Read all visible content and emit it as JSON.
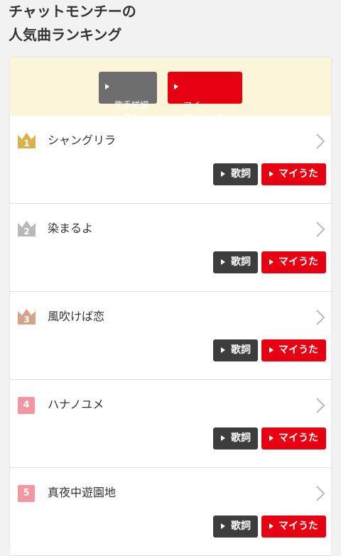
{
  "page": {
    "title": "チャットモンチーの\n人気曲ランキング"
  },
  "buttons": {
    "back_artist": "歌手詳細\nへ戻る",
    "my_artist": "マイ\nアーティスト"
  },
  "ranking": [
    {
      "rank": "1",
      "title": "シャングリラ",
      "lyrics_label": "歌詞",
      "myuta_label": "マイうた",
      "badge_color": "#d9b24c"
    },
    {
      "rank": "2",
      "title": "染まるよ",
      "lyrics_label": "歌詞",
      "myuta_label": "マイうた",
      "badge_color": "#b8b8b8"
    },
    {
      "rank": "3",
      "title": "風吹けば恋",
      "lyrics_label": "歌詞",
      "myuta_label": "マイうた",
      "badge_color": "#d4a38a"
    },
    {
      "rank": "4",
      "title": "ハナノユメ",
      "lyrics_label": "歌詞",
      "myuta_label": "マイうた",
      "badge_color": "#f5959f"
    },
    {
      "rank": "5",
      "title": "真夜中遊園地",
      "lyrics_label": "歌詞",
      "myuta_label": "マイうた",
      "badge_color": "#f5959f"
    }
  ],
  "colors": {
    "accent": "#e60012",
    "dark_button": "#3d3d3d",
    "gray_button": "#6e6e6e",
    "banner": "#fcf5d9"
  }
}
